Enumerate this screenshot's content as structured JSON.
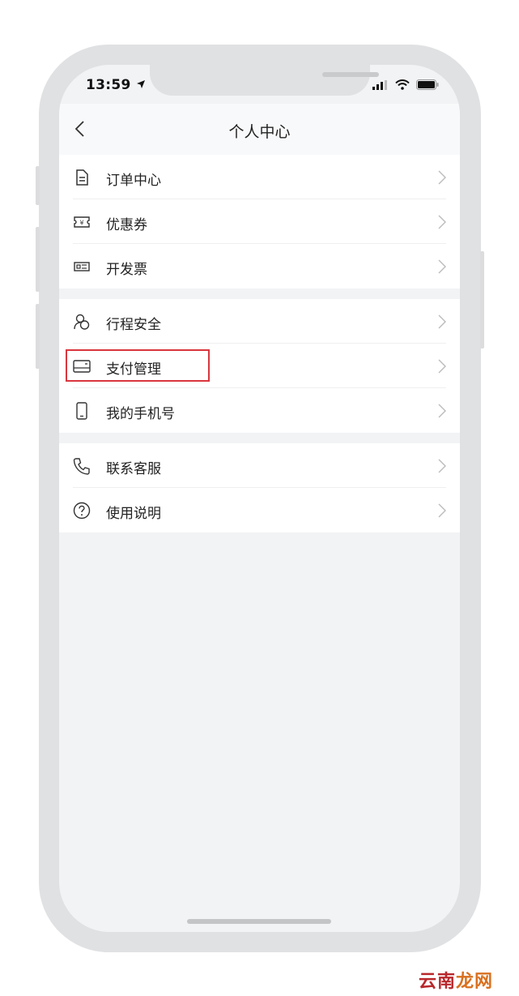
{
  "status_bar": {
    "time": "13:59"
  },
  "header": {
    "title": "个人中心"
  },
  "groups": [
    {
      "items": [
        {
          "label": "订单中心",
          "icon": "document-icon"
        },
        {
          "label": "优惠券",
          "icon": "coupon-icon"
        },
        {
          "label": "开发票",
          "icon": "invoice-icon"
        }
      ]
    },
    {
      "items": [
        {
          "label": "行程安全",
          "icon": "shield-people-icon"
        },
        {
          "label": "支付管理",
          "icon": "card-icon",
          "highlighted": true
        },
        {
          "label": "我的手机号",
          "icon": "phone-icon"
        }
      ]
    },
    {
      "items": [
        {
          "label": "联系客服",
          "icon": "phone-call-icon"
        },
        {
          "label": "使用说明",
          "icon": "help-icon"
        }
      ]
    }
  ],
  "watermark": {
    "part1": "云南",
    "part2": "龙网"
  },
  "colors": {
    "highlight": "#d9363e",
    "background": "#f2f3f5",
    "watermark": "#d9701f"
  }
}
